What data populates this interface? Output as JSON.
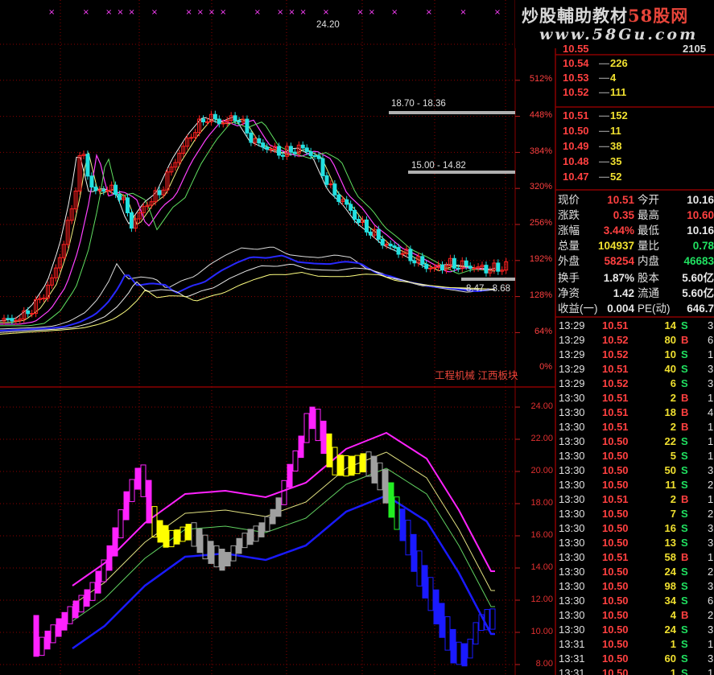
{
  "watermark": {
    "title_prefix": "炒股輔助教材",
    "title_accent": "58股网",
    "url": "www.58Gu.com"
  },
  "colors": {
    "background": "#000000",
    "grid": "#8b0000",
    "up": "#ff2020",
    "down": "#22e0e0",
    "magenta": "#ff22ff",
    "yellow": "#ffff00",
    "gray": "#a0a0a0",
    "green": "#22ee22",
    "blue": "#1a1aff"
  },
  "top_chart": {
    "pct_labels": [
      "512%",
      "448%",
      "384%",
      "320%",
      "256%",
      "192%",
      "128%",
      "64%",
      "0%"
    ],
    "annotations": {
      "high": "24.20",
      "range1": "18.70 - 18.36",
      "range2": "15.00 - 14.82",
      "range3": "8.47 - 8.68"
    },
    "sector_tags": "工程机械 江西板块"
  },
  "bottom_chart": {
    "price_labels": [
      "24.00",
      "22.00",
      "20.00",
      "18.00",
      "16.00",
      "14.00",
      "12.00",
      "10.00",
      "8.00"
    ]
  },
  "order_book": {
    "top_partial": {
      "price": "10.55",
      "vol": "2105"
    },
    "asks": [
      {
        "price": "10.54",
        "vol": "226"
      },
      {
        "price": "10.53",
        "vol": "4"
      },
      {
        "price": "10.52",
        "vol": "111"
      }
    ],
    "bids": [
      {
        "price": "10.51",
        "vol": "152"
      },
      {
        "price": "10.50",
        "vol": "11"
      },
      {
        "price": "10.49",
        "vol": "38"
      },
      {
        "price": "10.48",
        "vol": "35"
      },
      {
        "price": "10.47",
        "vol": "52"
      }
    ]
  },
  "quote": {
    "rows": [
      {
        "l1": "现价",
        "v1": "10.51",
        "c1": "red",
        "l2": "今开",
        "v2": "10.16",
        "c2": "wht"
      },
      {
        "l1": "涨跌",
        "v1": "0.35",
        "c1": "red",
        "l2": "最高",
        "v2": "10.60",
        "c2": "red"
      },
      {
        "l1": "涨幅",
        "v1": "3.44%",
        "c1": "red",
        "l2": "最低",
        "v2": "10.16",
        "c2": "wht"
      },
      {
        "l1": "总量",
        "v1": "104937",
        "c1": "yel",
        "l2": "量比",
        "v2": "0.78",
        "c2": "grn"
      },
      {
        "l1": "外盘",
        "v1": "58254",
        "c1": "red",
        "l2": "内盘",
        "v2": "46683",
        "c2": "grn"
      },
      {
        "l1": "换手",
        "v1": "1.87%",
        "c1": "wht",
        "l2": "股本",
        "v2": "5.60亿",
        "c2": "wht"
      },
      {
        "l1": "净资",
        "v1": "1.42",
        "c1": "wht",
        "l2": "流通",
        "v2": "5.60亿",
        "c2": "wht"
      },
      {
        "l1": "收益(一)",
        "v1": "0.004",
        "c1": "wht",
        "l2": "PE(动)",
        "v2": "646.7",
        "c2": "wht"
      }
    ]
  },
  "ticks": [
    {
      "time": "13:29",
      "price": "10.51",
      "vol": "14",
      "bs": "S",
      "n": "3"
    },
    {
      "time": "13:29",
      "price": "10.52",
      "vol": "80",
      "bs": "B",
      "n": "6"
    },
    {
      "time": "13:29",
      "price": "10.52",
      "vol": "10",
      "bs": "S",
      "n": "1"
    },
    {
      "time": "13:29",
      "price": "10.51",
      "vol": "40",
      "bs": "S",
      "n": "3"
    },
    {
      "time": "13:29",
      "price": "10.52",
      "vol": "6",
      "bs": "S",
      "n": "3"
    },
    {
      "time": "13:30",
      "price": "10.51",
      "vol": "2",
      "bs": "B",
      "n": "1"
    },
    {
      "time": "13:30",
      "price": "10.51",
      "vol": "18",
      "bs": "B",
      "n": "4"
    },
    {
      "time": "13:30",
      "price": "10.51",
      "vol": "2",
      "bs": "B",
      "n": "1"
    },
    {
      "time": "13:30",
      "price": "10.50",
      "vol": "22",
      "bs": "S",
      "n": "1"
    },
    {
      "time": "13:30",
      "price": "10.50",
      "vol": "5",
      "bs": "S",
      "n": "1"
    },
    {
      "time": "13:30",
      "price": "10.50",
      "vol": "50",
      "bs": "S",
      "n": "3"
    },
    {
      "time": "13:30",
      "price": "10.50",
      "vol": "11",
      "bs": "S",
      "n": "2"
    },
    {
      "time": "13:30",
      "price": "10.51",
      "vol": "2",
      "bs": "B",
      "n": "1"
    },
    {
      "time": "13:30",
      "price": "10.50",
      "vol": "7",
      "bs": "S",
      "n": "2"
    },
    {
      "time": "13:30",
      "price": "10.50",
      "vol": "16",
      "bs": "S",
      "n": "3"
    },
    {
      "time": "13:30",
      "price": "10.50",
      "vol": "13",
      "bs": "S",
      "n": "3"
    },
    {
      "time": "13:30",
      "price": "10.51",
      "vol": "58",
      "bs": "B",
      "n": "1"
    },
    {
      "time": "13:30",
      "price": "10.50",
      "vol": "24",
      "bs": "S",
      "n": "2"
    },
    {
      "time": "13:30",
      "price": "10.50",
      "vol": "98",
      "bs": "S",
      "n": "3"
    },
    {
      "time": "13:30",
      "price": "10.50",
      "vol": "34",
      "bs": "S",
      "n": "6"
    },
    {
      "time": "13:30",
      "price": "10.50",
      "vol": "4",
      "bs": "B",
      "n": "2"
    },
    {
      "time": "13:30",
      "price": "10.50",
      "vol": "24",
      "bs": "S",
      "n": "3"
    },
    {
      "time": "13:31",
      "price": "10.50",
      "vol": "1",
      "bs": "S",
      "n": "1"
    },
    {
      "time": "13:31",
      "price": "10.50",
      "vol": "60",
      "bs": "S",
      "n": "3"
    },
    {
      "time": "13:31",
      "price": "10.50",
      "vol": "1",
      "bs": "S",
      "n": "1"
    }
  ]
}
